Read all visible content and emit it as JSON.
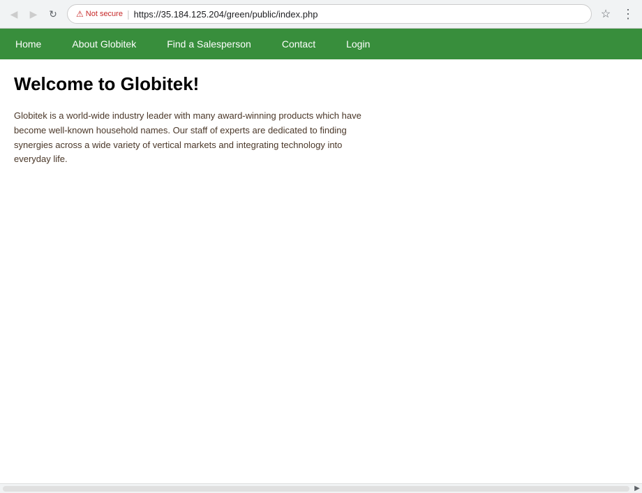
{
  "browser": {
    "url": "https://35.184.125.204/green/public/index.php",
    "security_label": "Not secure",
    "back_icon": "◀",
    "forward_icon": "▶",
    "reload_icon": "↻",
    "bookmark_icon": "☆",
    "more_icon": "⋮"
  },
  "nav": {
    "items": [
      {
        "label": "Home",
        "href": "#"
      },
      {
        "label": "About Globitek",
        "href": "#"
      },
      {
        "label": "Find a Salesperson",
        "href": "#"
      },
      {
        "label": "Contact",
        "href": "#"
      },
      {
        "label": "Login",
        "href": "#"
      }
    ]
  },
  "main": {
    "title": "Welcome to Globitek!",
    "description": "Globitek is a world-wide industry leader with many award-winning products which have become well-known household names. Our staff of experts are dedicated to finding synergies across a wide variety of vertical markets and integrating technology into everyday life."
  }
}
